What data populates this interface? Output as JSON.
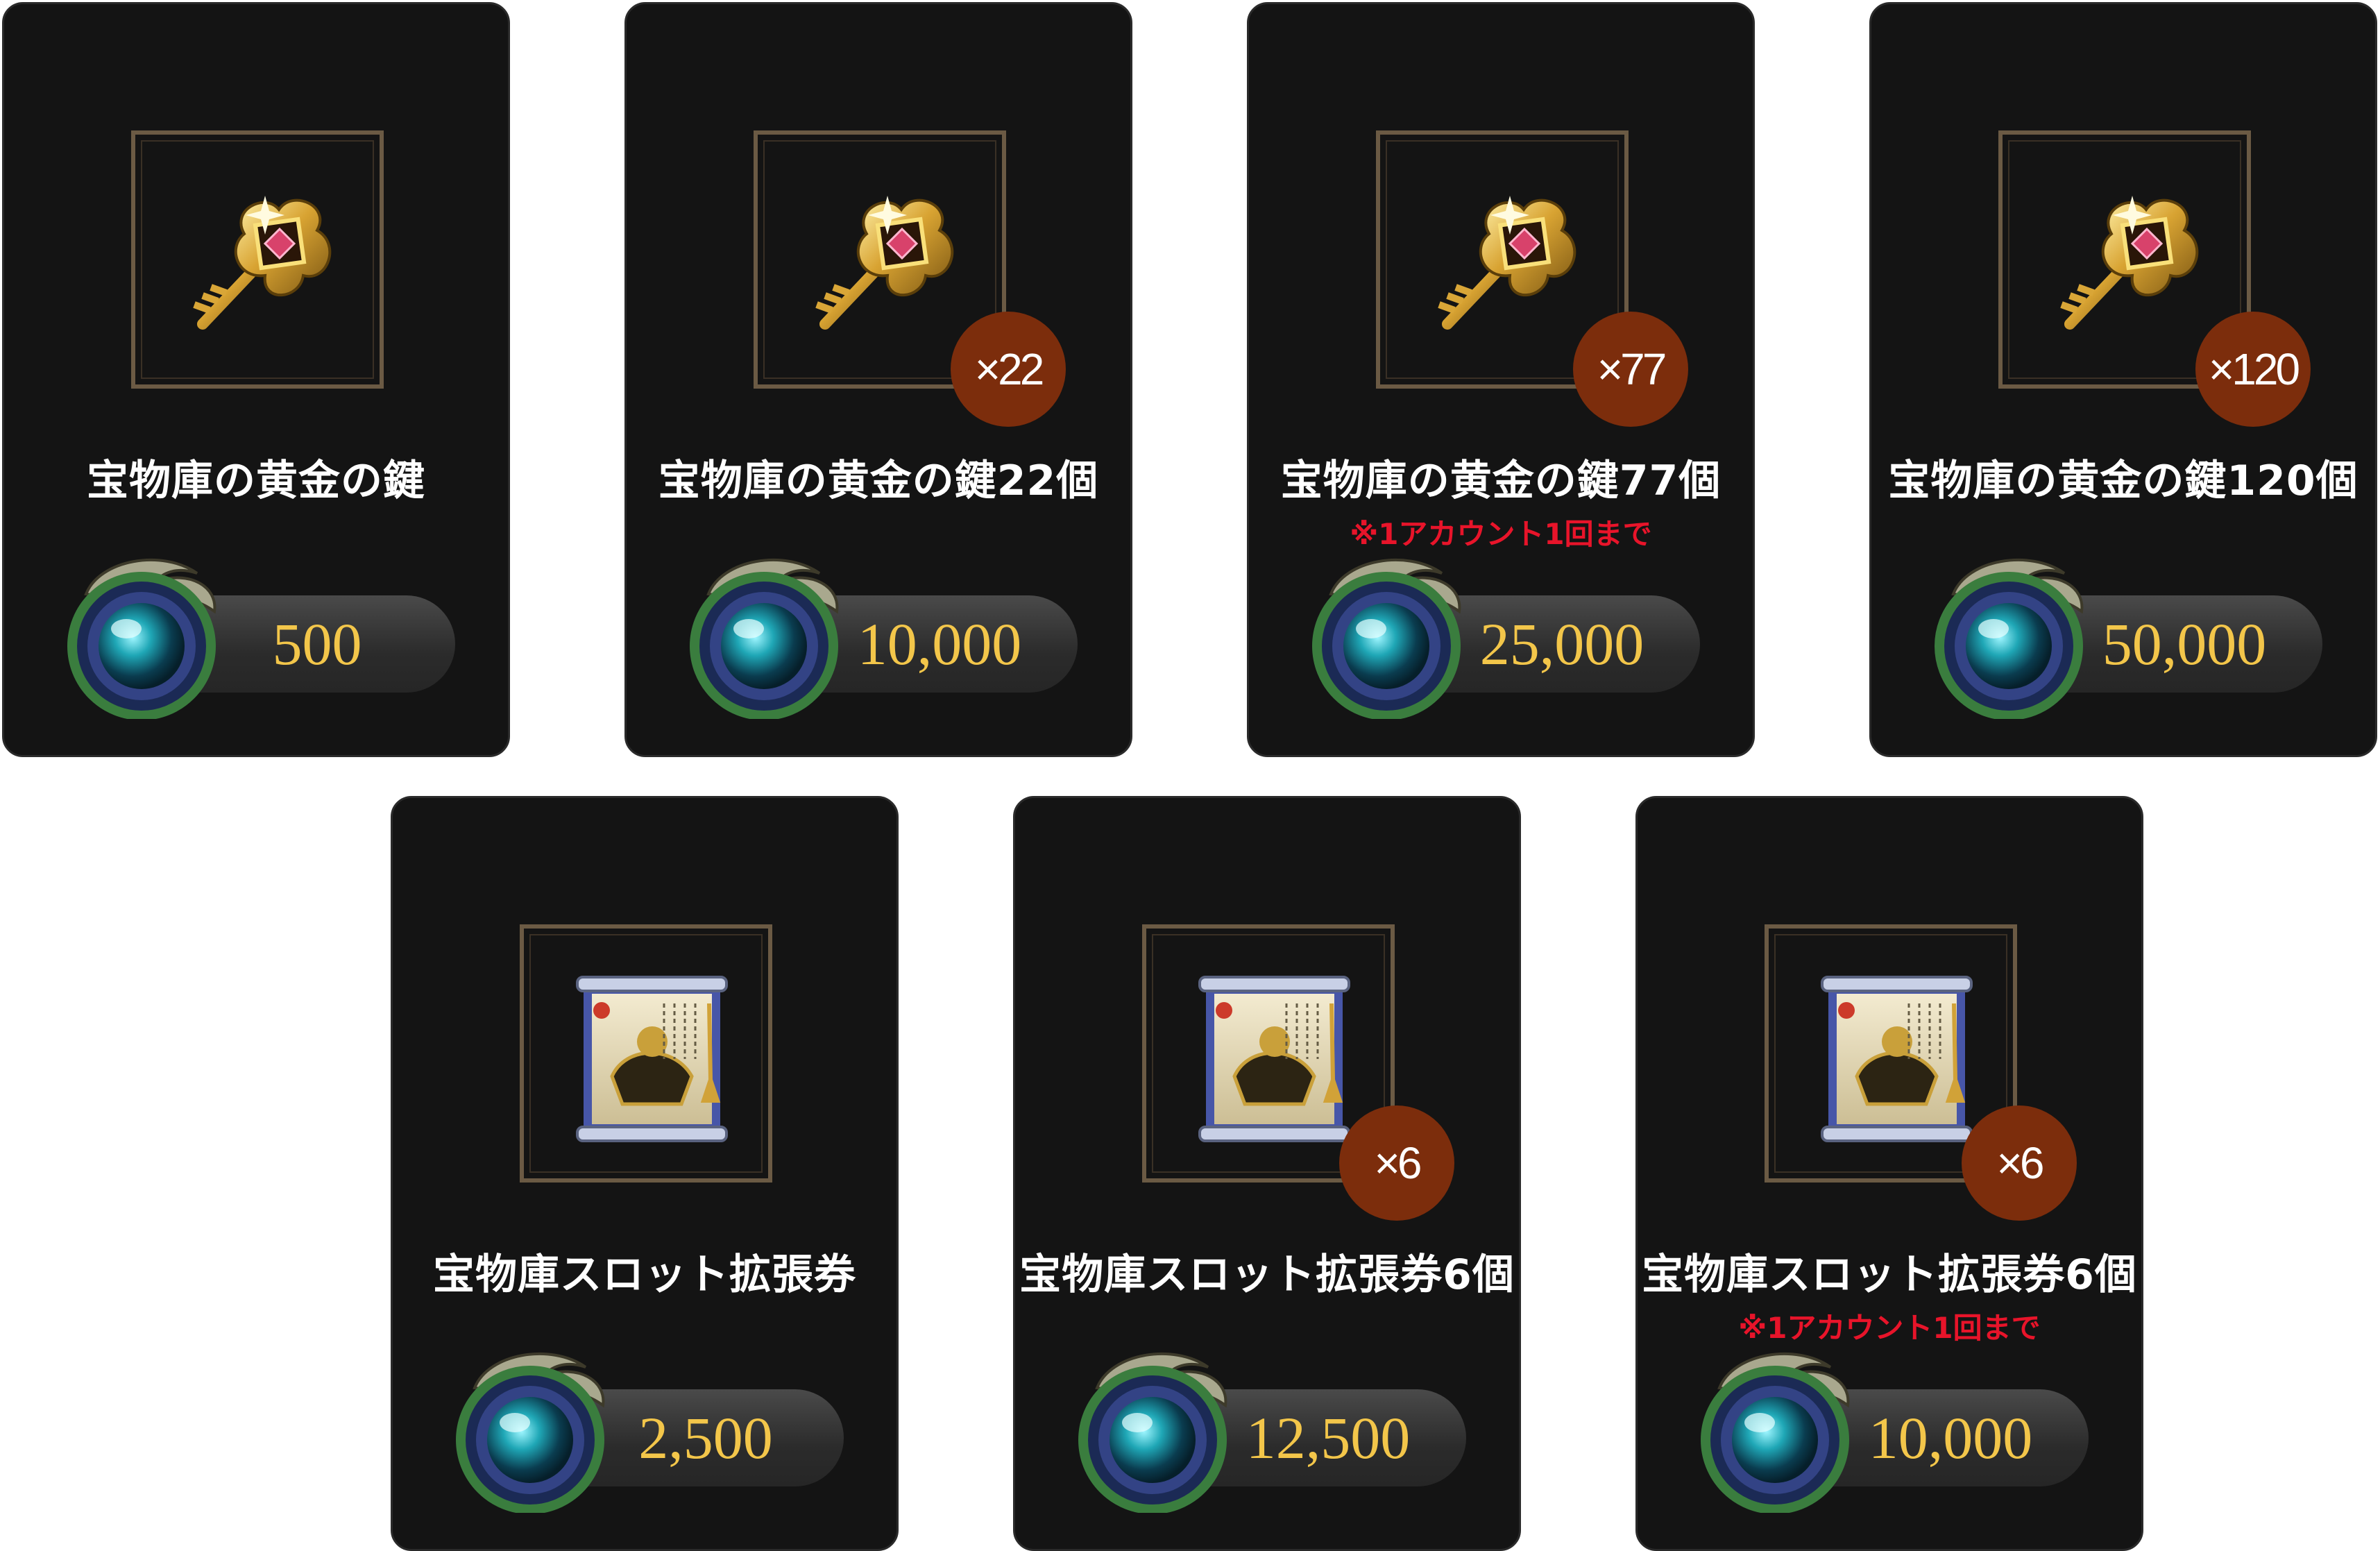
{
  "cards": [
    {
      "title": "宝物庫の黄金の鍵",
      "badge": "",
      "note": "",
      "price": "500",
      "icon": "golden-key-icon"
    },
    {
      "title": "宝物庫の黄金の鍵22個",
      "badge": "×22",
      "note": "",
      "price": "10,000",
      "icon": "golden-key-icon"
    },
    {
      "title": "宝物庫の黄金の鍵77個",
      "badge": "×77",
      "note": "※1アカウント1回まで",
      "price": "25,000",
      "icon": "golden-key-icon"
    },
    {
      "title": "宝物庫の黄金の鍵120個",
      "badge": "×120",
      "note": "",
      "price": "50,000",
      "icon": "golden-key-icon"
    },
    {
      "title": "宝物庫スロット拡張券",
      "badge": "",
      "note": "",
      "price": "2,500",
      "icon": "scroll-ticket-icon"
    },
    {
      "title": "宝物庫スロット拡張券6個",
      "badge": "×6",
      "note": "",
      "price": "12,500",
      "icon": "scroll-ticket-icon"
    },
    {
      "title": "宝物庫スロット拡張券6個",
      "badge": "×6",
      "note": "※1アカウント1回まで",
      "price": "10,000",
      "icon": "scroll-ticket-icon"
    }
  ],
  "currency_icon": "gem-orb-icon",
  "colors": {
    "card_bg": "#141414",
    "price": "#f3c64a",
    "badge": "#7c2d0c",
    "note": "#e8142a"
  }
}
